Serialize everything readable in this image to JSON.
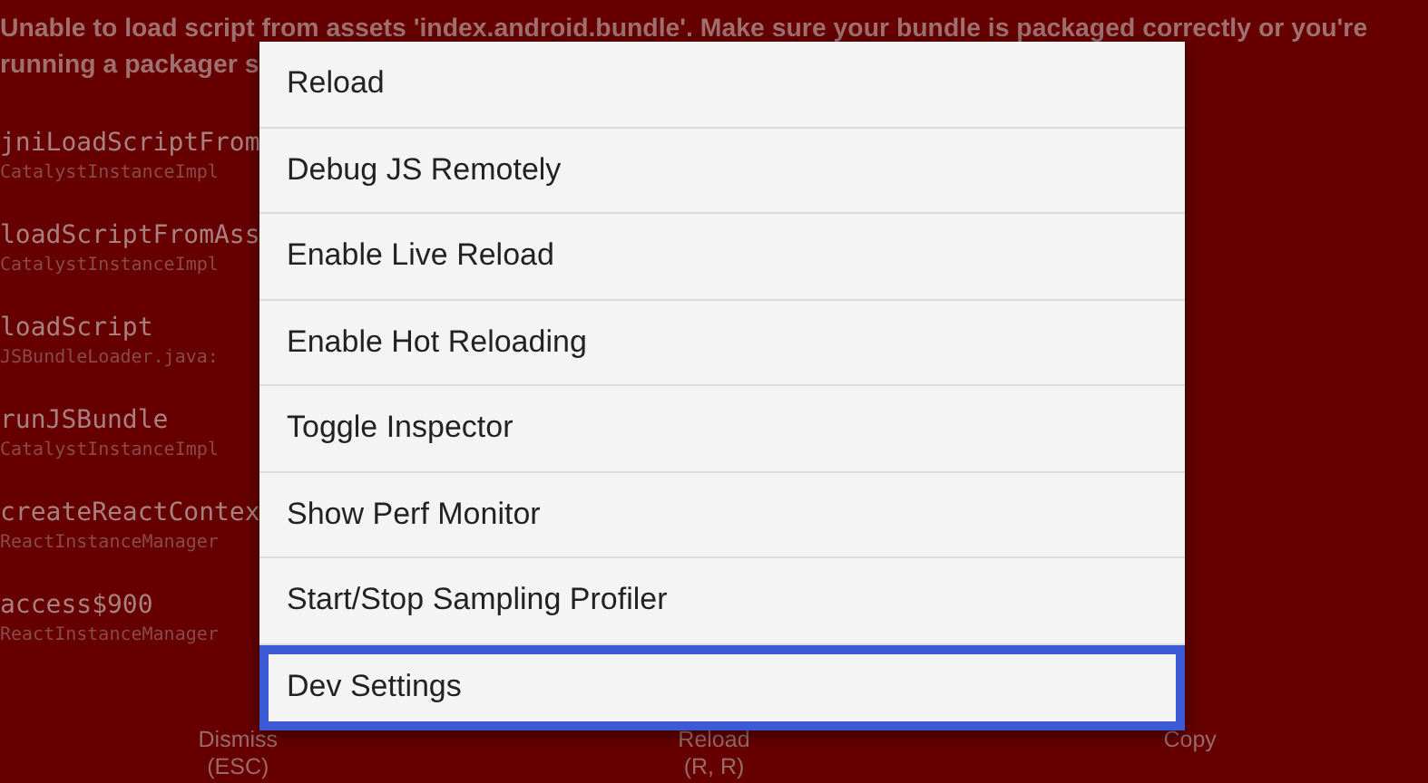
{
  "error_screen": {
    "title_lines": [
      "Unable to load script from assets 'index.android.bundle'. Make sure your bundle is packaged correctly or you're",
      "running a packager s"
    ],
    "stack_frames": [
      {
        "method": "jniLoadScriptFrom",
        "file": "CatalystInstanceImpl"
      },
      {
        "method": "loadScriptFromAss",
        "file": "CatalystInstanceImpl"
      },
      {
        "method": "loadScript",
        "file": "JSBundleLoader.java:"
      },
      {
        "method": "runJSBundle",
        "file": "CatalystInstanceImpl"
      },
      {
        "method": "createReactContex",
        "file": "ReactInstanceManager"
      },
      {
        "method": "access$900",
        "file": "ReactInstanceManager"
      }
    ],
    "buttons": [
      {
        "label": "Dismiss",
        "shortcut": "(ESC)"
      },
      {
        "label": "Reload",
        "shortcut": "(R, R)"
      },
      {
        "label": "Copy"
      }
    ]
  },
  "dev_menu": {
    "items": [
      {
        "label": "Reload",
        "selected": false
      },
      {
        "label": "Debug JS Remotely",
        "selected": false
      },
      {
        "label": "Enable Live Reload",
        "selected": false
      },
      {
        "label": "Enable Hot Reloading",
        "selected": false
      },
      {
        "label": "Toggle Inspector",
        "selected": false
      },
      {
        "label": "Show Perf Monitor",
        "selected": false
      },
      {
        "label": "Start/Stop Sampling Profiler",
        "selected": false
      },
      {
        "label": "Dev Settings",
        "selected": true
      }
    ]
  }
}
